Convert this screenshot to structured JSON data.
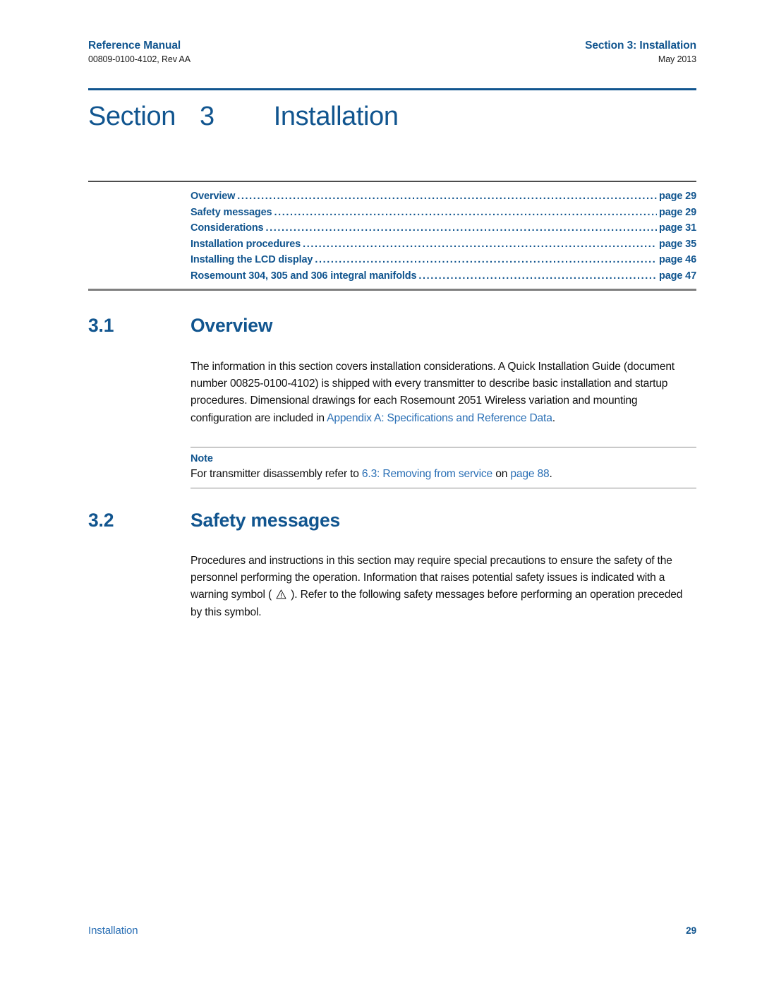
{
  "header": {
    "left_title": "Reference Manual",
    "left_sub": "00809-0100-4102, Rev AA",
    "right_title": "Section 3: Installation",
    "right_sub": "May 2013"
  },
  "section_title": {
    "word": "Section",
    "number": "3",
    "name": "Installation"
  },
  "toc": {
    "dots": "...........................................................................................................",
    "rows": [
      {
        "label": "Overview",
        "page": "page 29"
      },
      {
        "label": "Safety messages",
        "page": "page 29"
      },
      {
        "label": "Considerations",
        "page": "page 31"
      },
      {
        "label": "Installation procedures",
        "page": "page 35"
      },
      {
        "label": "Installing the LCD display",
        "page": "page 46"
      },
      {
        "label": "Rosemount 304, 305 and 306 integral manifolds",
        "page": "page 47"
      }
    ]
  },
  "section_3_1": {
    "number": "3.1",
    "title": "Overview",
    "body_part_1": "The information in this section covers installation considerations. A Quick Installation Guide (document number 00825-0100-4102) is shipped with every transmitter to describe basic installation and startup procedures. Dimensional drawings for each Rosemount 2051 Wireless variation and mounting configuration are included in ",
    "body_link": "Appendix A: Specifications and Reference Data",
    "body_part_2": "."
  },
  "note": {
    "title": "Note",
    "text_part_1": "For transmitter disassembly refer to ",
    "link_1": "6.3: Removing from service",
    "text_part_2": " on ",
    "link_2": "page 88",
    "text_part_3": "."
  },
  "section_3_2": {
    "number": "3.2",
    "title": "Safety messages",
    "body_part_1": "Procedures and instructions in this section may require special precautions to ensure the safety of the personnel performing the operation. Information that raises potential safety issues is indicated with a warning symbol ( ",
    "body_part_2": " ). Refer to the following safety messages before performing an operation preceded by this symbol."
  },
  "footer": {
    "label": "Installation",
    "page_number": "29"
  },
  "colors": {
    "brand_blue": "#11558f",
    "link_blue": "#2a6fb5",
    "rule_gray": "#808080"
  }
}
